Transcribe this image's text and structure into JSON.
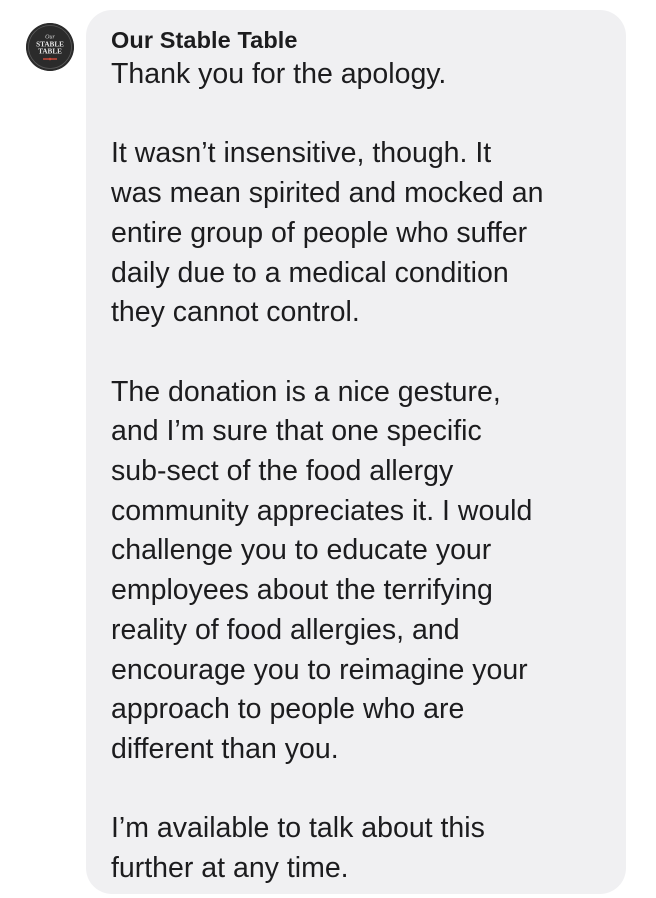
{
  "sender": {
    "name": "Our Stable Table",
    "avatar": {
      "icon": "restaurant-logo-icon",
      "text_lines": [
        "Our",
        "STABLE",
        "TABLE"
      ]
    }
  },
  "message": {
    "paragraphs": [
      {
        "lines": [
          "Thank you for the apology."
        ]
      },
      {
        "lines": [
          "It wasn’t insensitive, though. It",
          "was mean spirited and mocked an",
          "entire group of people who suffer",
          "daily due to a medical condition",
          "they cannot control."
        ]
      },
      {
        "lines": [
          "The donation is a nice gesture,",
          "and I’m sure that one specific",
          "sub-sect of the food allergy",
          "community appreciates it. I would",
          "challenge you to educate your",
          "employees about the terrifying",
          "reality of food allergies, and",
          "encourage you to reimagine your",
          "approach to people who are",
          "different than you."
        ]
      },
      {
        "lines": [
          "I’m available to talk about this",
          "further at any time."
        ]
      }
    ]
  },
  "colors": {
    "bubble_background": "#f0f0f2",
    "text": "#1c1c1e",
    "avatar_background": "#2b2b2b"
  }
}
